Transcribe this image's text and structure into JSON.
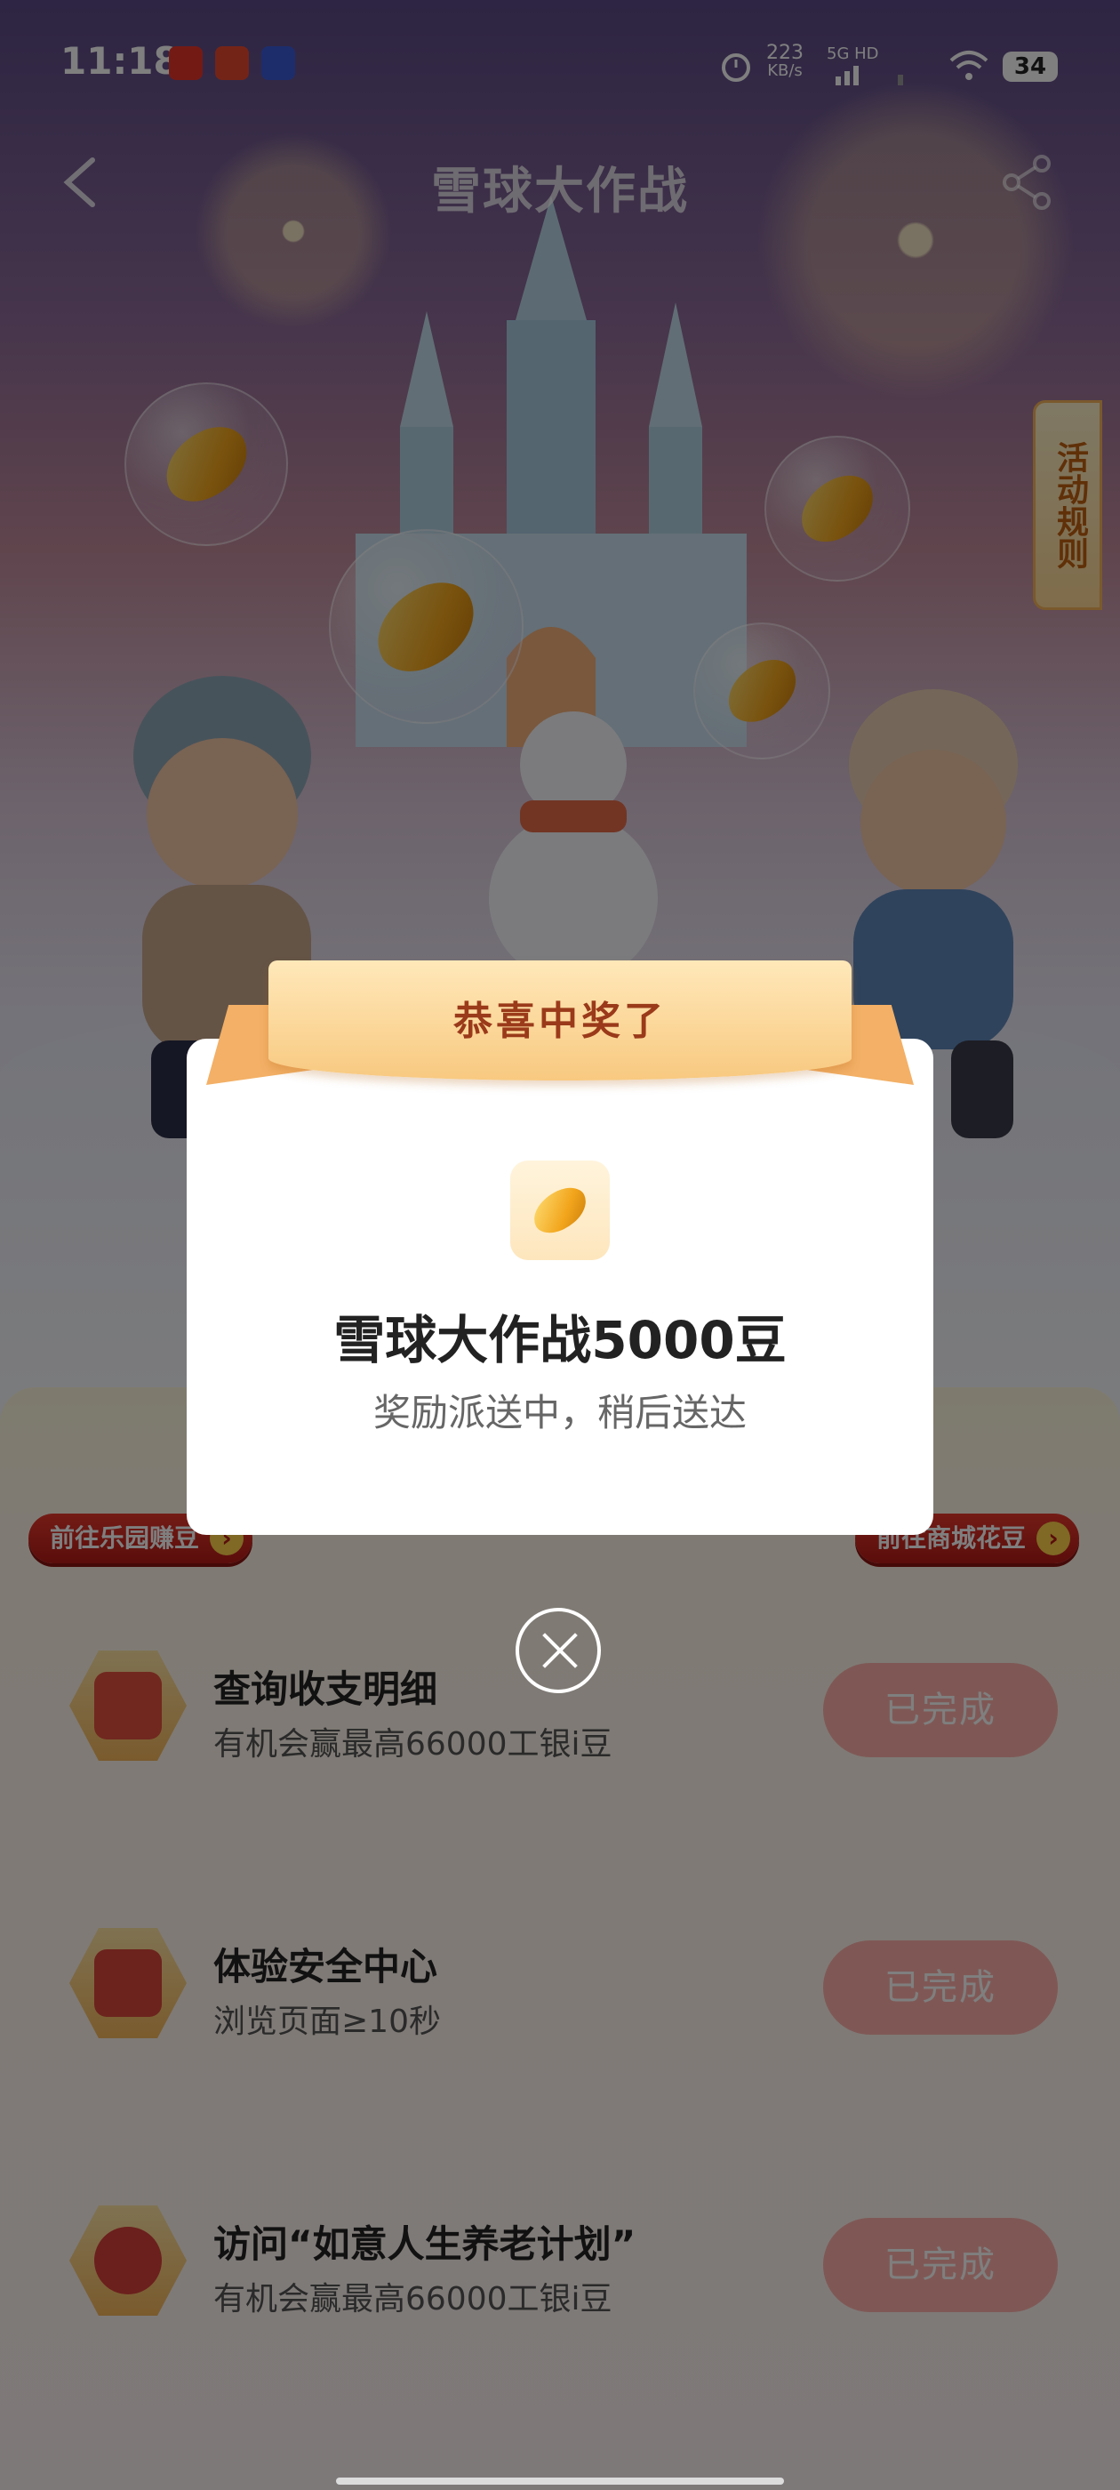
{
  "status_bar": {
    "time": "11:18",
    "speed_value": "223",
    "speed_unit": "KB/s",
    "network": "5G HD",
    "battery": "34",
    "app_icons": [
      "video-app-icon",
      "taobao-app-icon",
      "qq-app-icon"
    ]
  },
  "header": {
    "title": "雪球大作战"
  },
  "rules_tab": {
    "label": "活动规则"
  },
  "shortcuts": {
    "left_label": "前往乐园赚豆",
    "right_label": "前往商城花豆"
  },
  "tasks": [
    {
      "name": "查询收支明细",
      "desc": "有机会赢最高66000工银i豆",
      "status": "已完成",
      "icon": "receipt-icon"
    },
    {
      "name": "体验安全中心",
      "desc": "浏览页面≥10秒",
      "status": "已完成",
      "icon": "clipboard-icon"
    },
    {
      "name": "访问“如意人生养老计划”",
      "desc": "有机会赢最高66000工银i豆",
      "status": "已完成",
      "icon": "magnifier-icon"
    }
  ],
  "modal": {
    "banner": "恭喜中奖了",
    "prize": "雪球大作战5000豆",
    "note": "奖励派送中，稍后送达",
    "icon": "bean-icon"
  },
  "colors": {
    "accent_red": "#b51b17",
    "done_pill": "#ffb0ab",
    "ribbon": "#f8c980",
    "ribbon_text": "#9a3a1a"
  }
}
